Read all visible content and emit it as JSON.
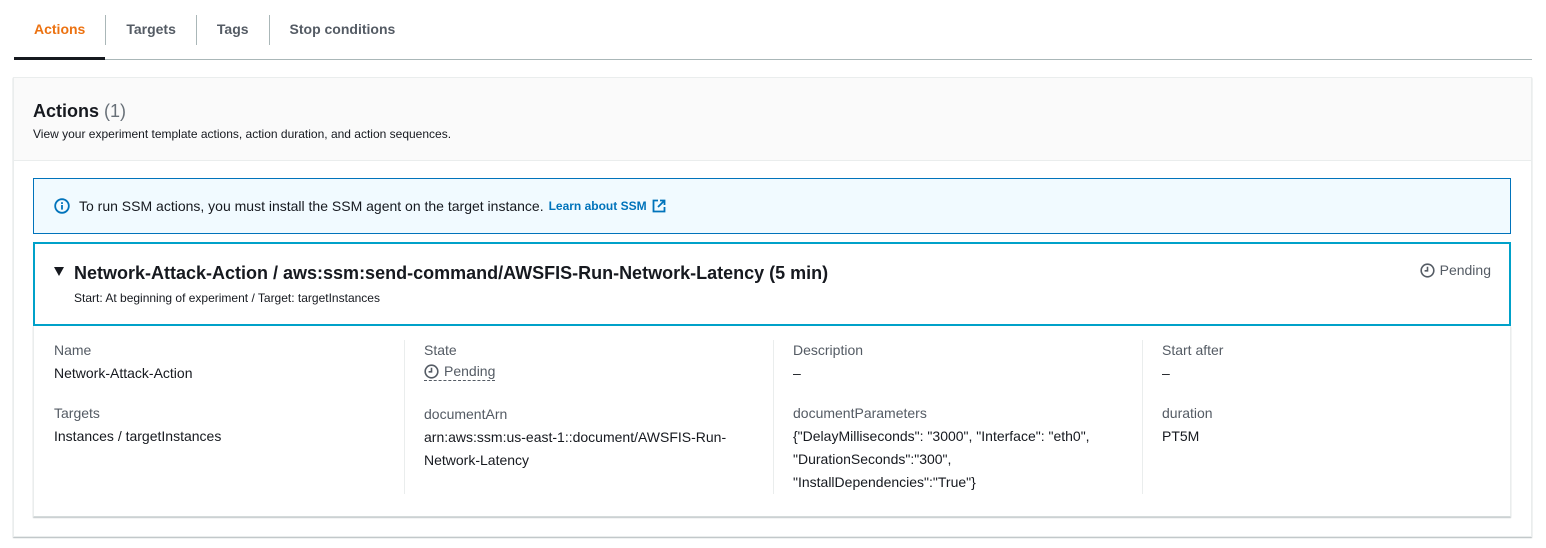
{
  "tabs": [
    {
      "label": "Actions",
      "active": true
    },
    {
      "label": "Targets",
      "active": false
    },
    {
      "label": "Tags",
      "active": false
    },
    {
      "label": "Stop conditions",
      "active": false
    }
  ],
  "container": {
    "title": "Actions",
    "count": "(1)",
    "description": "View your experiment template actions, action duration, and action sequences."
  },
  "alert": {
    "icon": "info-icon",
    "text": "To run SSM actions, you must install the SSM agent on the target instance.",
    "link_label": "Learn about SSM",
    "link_icon": "external-link-icon"
  },
  "action": {
    "title": "Network-Attack-Action / aws:ssm:send-command/AWSFIS-Run-Network-Latency (5 min)",
    "subtitle": "Start: At beginning of experiment / Target: targetInstances",
    "status": "Pending",
    "status_icon": "clock-icon"
  },
  "details": {
    "name_label": "Name",
    "name_value": "Network-Attack-Action",
    "targets_label": "Targets",
    "targets_value": "Instances / targetInstances",
    "state_label": "State",
    "state_value": "Pending",
    "document_arn_label": "documentArn",
    "document_arn_line1": "arn:aws:ssm:us-east-1::document/AWSFIS-Run-",
    "document_arn_line2": "Network-Latency",
    "description_label": "Description",
    "description_value": "–",
    "document_params_label": "documentParameters",
    "document_params_line1": "{\"DelayMilliseconds\": \"3000\", \"Interface\": \"eth0\",",
    "document_params_line2": "\"DurationSeconds\":\"300\",",
    "document_params_line3": "\"InstallDependencies\":\"True\"}",
    "start_after_label": "Start after",
    "start_after_value": "–",
    "duration_label": "duration",
    "duration_value": "PT5M"
  },
  "colors": {
    "accent": "#ec7211",
    "link": "#0073bb",
    "card_border": "#00a1c9",
    "alert_bg": "#f1faff"
  }
}
